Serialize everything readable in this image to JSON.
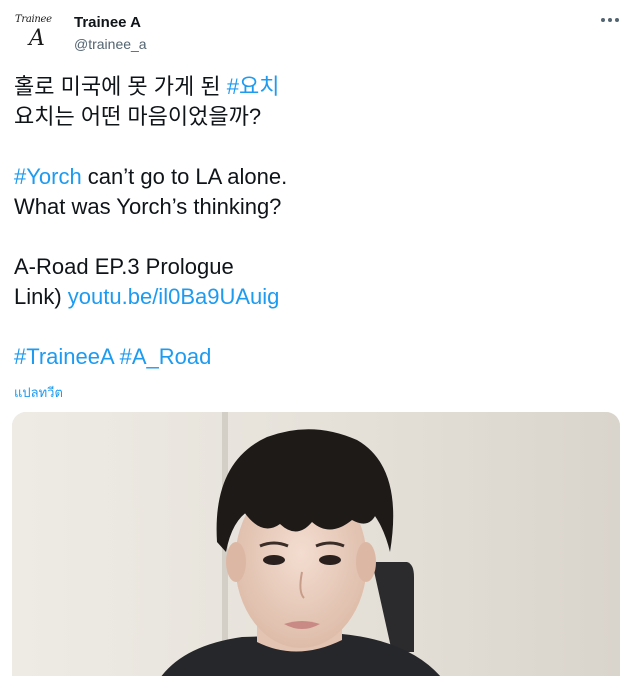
{
  "author": {
    "avatar_logo_top": "Trainee",
    "avatar_logo_letter": "A",
    "display_name": "Trainee A",
    "handle": "@trainee_a"
  },
  "more_icon": "more-horizontal-icon",
  "tweet": {
    "korean_line1_text": "홀로 미국에 못 가게 된 ",
    "korean_line1_hashtag": "#요치",
    "korean_line2": "요치는 어떤 마음이었을까?",
    "english_line1_hashtag": "#Yorch",
    "english_line1_text": " can’t go to LA alone.",
    "english_line2": "What was Yorch’s thinking?",
    "promo_line1": "A-Road EP.3 Prologue",
    "promo_line2_label": "Link) ",
    "promo_line2_link": "youtu.be/il0Ba9UAuig",
    "hashtag1": "#TraineeA",
    "hashtag2": "#A_Road"
  },
  "translate_label": "แปลทวีต",
  "colors": {
    "link": "#1d9bf0",
    "text": "#0f1419",
    "secondary": "#536471"
  }
}
